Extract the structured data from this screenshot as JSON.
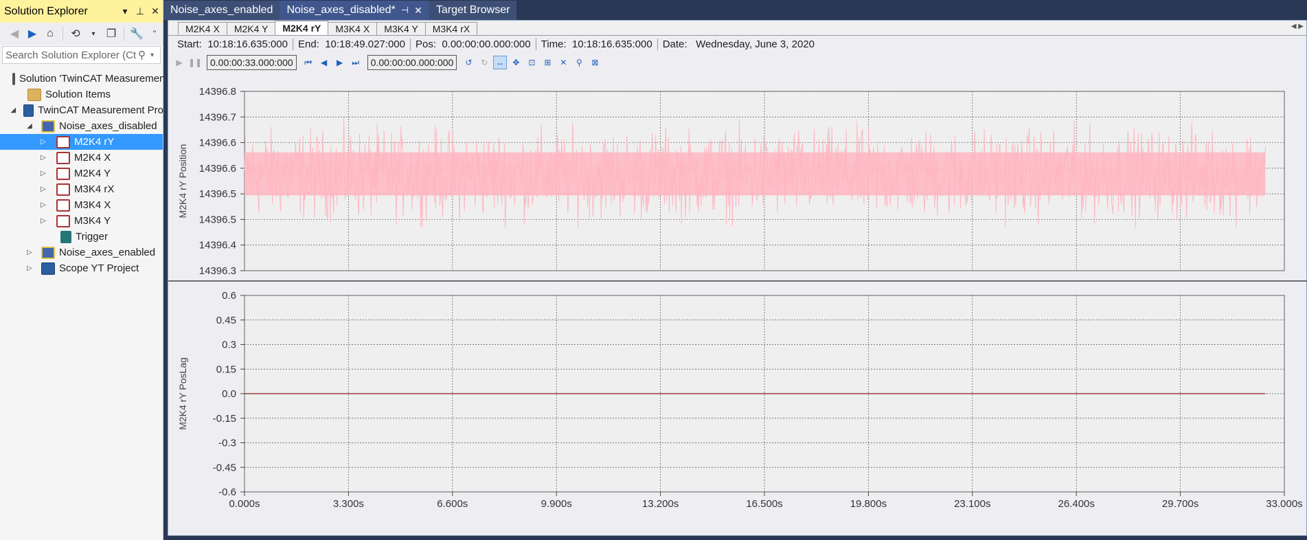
{
  "solution_explorer": {
    "title": "Solution Explorer",
    "search_placeholder": "Search Solution Explorer (Ct",
    "tree": [
      {
        "label": "Solution 'TwinCAT Measurement",
        "icon": "solution-icon"
      },
      {
        "label": "Solution Items",
        "icon": "folder-icon"
      },
      {
        "label": "TwinCAT Measurement Pro",
        "icon": "measurement-project-icon"
      },
      {
        "label": "Noise_axes_disabled",
        "icon": "scope-config-icon"
      },
      {
        "label": "M2K4 rY",
        "icon": "chart-icon"
      },
      {
        "label": "M2K4 X",
        "icon": "chart-icon"
      },
      {
        "label": "M2K4 Y",
        "icon": "chart-icon"
      },
      {
        "label": "M3K4 rX",
        "icon": "chart-icon"
      },
      {
        "label": "M3K4 X",
        "icon": "chart-icon"
      },
      {
        "label": "M3K4 Y",
        "icon": "chart-icon"
      },
      {
        "label": "Trigger",
        "icon": "trigger-icon"
      },
      {
        "label": "Noise_axes_enabled",
        "icon": "scope-config-icon"
      },
      {
        "label": "Scope YT Project",
        "icon": "scope-project-icon"
      }
    ]
  },
  "doc_tabs": [
    "Noise_axes_enabled",
    "Noise_axes_disabled*",
    "Target Browser"
  ],
  "chart_tabs": [
    "M2K4 X",
    "M2K4 Y",
    "M2K4 rY",
    "M3K4 X",
    "M3K4 Y",
    "M3K4 rX"
  ],
  "info": {
    "start_label": "Start:",
    "start": "10:18:16.635:000",
    "end_label": "End:",
    "end": "10:18:49.027:000",
    "pos_label": "Pos:",
    "pos": "0.00:00:00.000:000",
    "time_label": "Time:",
    "time": "10:18:16.635:000",
    "date_label": "Date:",
    "date": "Wednesday, June 3, 2020"
  },
  "controls": {
    "span": "0.00:00:33.000:000",
    "position": "0.00:00:00.000:000"
  },
  "colors": {
    "accent_selected": "#3399ff",
    "noise_signal": "#ffb6c1",
    "lag_signal": "#8b1a1a",
    "title_highlight": "#fff29d"
  },
  "chart_data": [
    {
      "type": "line",
      "ylabel": "M2K4 rY Position",
      "yticks": [
        "14396.8",
        "14396.7",
        "14396.6",
        "14396.6",
        "14396.5",
        "14396.5",
        "14396.4",
        "14396.3"
      ],
      "ylim": [
        14396.3,
        14396.8
      ],
      "series": [
        {
          "center": 14396.57,
          "noise_band": [
            14396.42,
            14396.74
          ]
        }
      ],
      "x_end": 32.4
    },
    {
      "type": "line",
      "ylabel": "M2K4 rY PosLag",
      "yticks": [
        "0.6",
        "0.45",
        "0.3",
        "0.15",
        "0.0",
        "-0.15",
        "-0.3",
        "-0.45",
        "-0.6"
      ],
      "ylim": [
        -0.6,
        0.6
      ],
      "series": [
        {
          "value": 0.0
        }
      ],
      "x_end": 32.4
    }
  ],
  "xticks": [
    "0.000s",
    "3.300s",
    "6.600s",
    "9.900s",
    "13.200s",
    "16.500s",
    "19.800s",
    "23.100s",
    "26.400s",
    "29.700s",
    "33.000s"
  ],
  "xlim": [
    0,
    33
  ]
}
